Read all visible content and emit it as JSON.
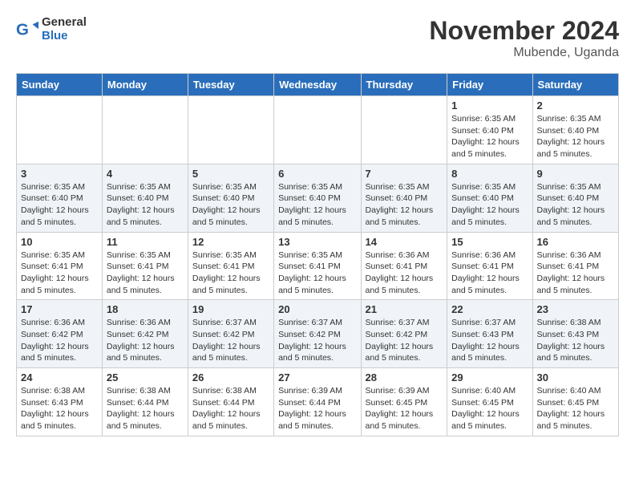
{
  "header": {
    "logo_general": "General",
    "logo_blue": "Blue",
    "month_title": "November 2024",
    "location": "Mubende, Uganda"
  },
  "weekdays": [
    "Sunday",
    "Monday",
    "Tuesday",
    "Wednesday",
    "Thursday",
    "Friday",
    "Saturday"
  ],
  "weeks": [
    [
      {
        "day": "",
        "info": ""
      },
      {
        "day": "",
        "info": ""
      },
      {
        "day": "",
        "info": ""
      },
      {
        "day": "",
        "info": ""
      },
      {
        "day": "",
        "info": ""
      },
      {
        "day": "1",
        "info": "Sunrise: 6:35 AM\nSunset: 6:40 PM\nDaylight: 12 hours and 5 minutes."
      },
      {
        "day": "2",
        "info": "Sunrise: 6:35 AM\nSunset: 6:40 PM\nDaylight: 12 hours and 5 minutes."
      }
    ],
    [
      {
        "day": "3",
        "info": "Sunrise: 6:35 AM\nSunset: 6:40 PM\nDaylight: 12 hours and 5 minutes."
      },
      {
        "day": "4",
        "info": "Sunrise: 6:35 AM\nSunset: 6:40 PM\nDaylight: 12 hours and 5 minutes."
      },
      {
        "day": "5",
        "info": "Sunrise: 6:35 AM\nSunset: 6:40 PM\nDaylight: 12 hours and 5 minutes."
      },
      {
        "day": "6",
        "info": "Sunrise: 6:35 AM\nSunset: 6:40 PM\nDaylight: 12 hours and 5 minutes."
      },
      {
        "day": "7",
        "info": "Sunrise: 6:35 AM\nSunset: 6:40 PM\nDaylight: 12 hours and 5 minutes."
      },
      {
        "day": "8",
        "info": "Sunrise: 6:35 AM\nSunset: 6:40 PM\nDaylight: 12 hours and 5 minutes."
      },
      {
        "day": "9",
        "info": "Sunrise: 6:35 AM\nSunset: 6:40 PM\nDaylight: 12 hours and 5 minutes."
      }
    ],
    [
      {
        "day": "10",
        "info": "Sunrise: 6:35 AM\nSunset: 6:41 PM\nDaylight: 12 hours and 5 minutes."
      },
      {
        "day": "11",
        "info": "Sunrise: 6:35 AM\nSunset: 6:41 PM\nDaylight: 12 hours and 5 minutes."
      },
      {
        "day": "12",
        "info": "Sunrise: 6:35 AM\nSunset: 6:41 PM\nDaylight: 12 hours and 5 minutes."
      },
      {
        "day": "13",
        "info": "Sunrise: 6:35 AM\nSunset: 6:41 PM\nDaylight: 12 hours and 5 minutes."
      },
      {
        "day": "14",
        "info": "Sunrise: 6:36 AM\nSunset: 6:41 PM\nDaylight: 12 hours and 5 minutes."
      },
      {
        "day": "15",
        "info": "Sunrise: 6:36 AM\nSunset: 6:41 PM\nDaylight: 12 hours and 5 minutes."
      },
      {
        "day": "16",
        "info": "Sunrise: 6:36 AM\nSunset: 6:41 PM\nDaylight: 12 hours and 5 minutes."
      }
    ],
    [
      {
        "day": "17",
        "info": "Sunrise: 6:36 AM\nSunset: 6:42 PM\nDaylight: 12 hours and 5 minutes."
      },
      {
        "day": "18",
        "info": "Sunrise: 6:36 AM\nSunset: 6:42 PM\nDaylight: 12 hours and 5 minutes."
      },
      {
        "day": "19",
        "info": "Sunrise: 6:37 AM\nSunset: 6:42 PM\nDaylight: 12 hours and 5 minutes."
      },
      {
        "day": "20",
        "info": "Sunrise: 6:37 AM\nSunset: 6:42 PM\nDaylight: 12 hours and 5 minutes."
      },
      {
        "day": "21",
        "info": "Sunrise: 6:37 AM\nSunset: 6:42 PM\nDaylight: 12 hours and 5 minutes."
      },
      {
        "day": "22",
        "info": "Sunrise: 6:37 AM\nSunset: 6:43 PM\nDaylight: 12 hours and 5 minutes."
      },
      {
        "day": "23",
        "info": "Sunrise: 6:38 AM\nSunset: 6:43 PM\nDaylight: 12 hours and 5 minutes."
      }
    ],
    [
      {
        "day": "24",
        "info": "Sunrise: 6:38 AM\nSunset: 6:43 PM\nDaylight: 12 hours and 5 minutes."
      },
      {
        "day": "25",
        "info": "Sunrise: 6:38 AM\nSunset: 6:44 PM\nDaylight: 12 hours and 5 minutes."
      },
      {
        "day": "26",
        "info": "Sunrise: 6:38 AM\nSunset: 6:44 PM\nDaylight: 12 hours and 5 minutes."
      },
      {
        "day": "27",
        "info": "Sunrise: 6:39 AM\nSunset: 6:44 PM\nDaylight: 12 hours and 5 minutes."
      },
      {
        "day": "28",
        "info": "Sunrise: 6:39 AM\nSunset: 6:45 PM\nDaylight: 12 hours and 5 minutes."
      },
      {
        "day": "29",
        "info": "Sunrise: 6:40 AM\nSunset: 6:45 PM\nDaylight: 12 hours and 5 minutes."
      },
      {
        "day": "30",
        "info": "Sunrise: 6:40 AM\nSunset: 6:45 PM\nDaylight: 12 hours and 5 minutes."
      }
    ]
  ]
}
